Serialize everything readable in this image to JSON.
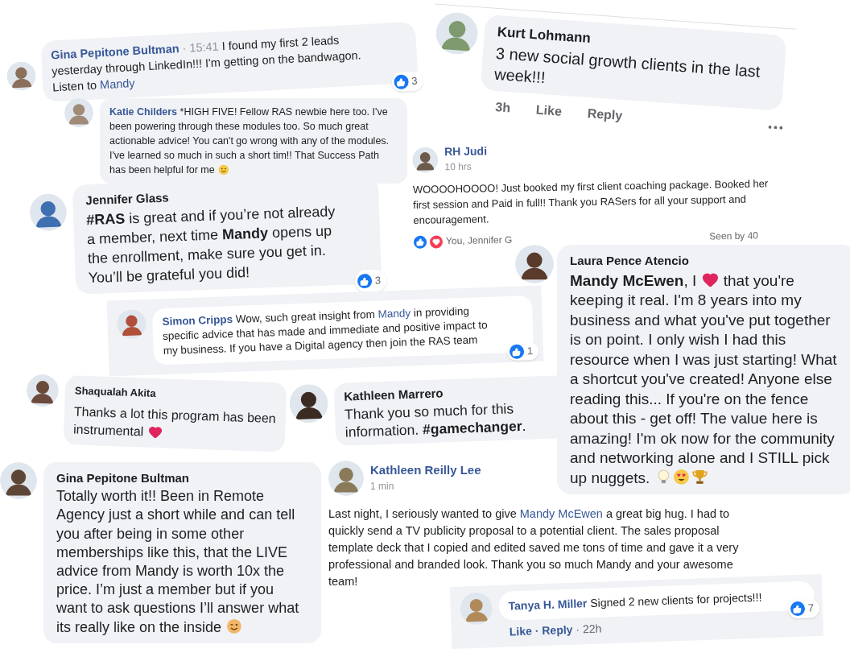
{
  "comments": [
    {
      "kind": "inline",
      "name": "Gina Pepitone Bultman",
      "time": "· 15:41",
      "text": [
        "I found my first 2 leads yesterday through LinkedIn!!! I'm getting on the bandwagon. Listen to ",
        {
          "kind": "link",
          "t": "Mandy"
        }
      ],
      "reactions": "3"
    },
    {
      "kind": "inline",
      "name": "Katie Childers",
      "text": [
        "*HIGH FIVE! Fellow RAS newbie here too. I've been powering through these modules too. So much great actionable advice! You can't go wrong with any of the modules. I've learned so much in such a short tim!! That Success Path has been helpful for me ",
        {
          "kind": "smile"
        }
      ]
    },
    {
      "kind": "bubble",
      "name": "Kurt Lohmann",
      "text": [
        "3 new social growth clients in the last week!!!"
      ],
      "actions": [
        "3h",
        "Like",
        "Reply"
      ],
      "more": true
    },
    {
      "kind": "post",
      "name": "RH Judi",
      "time": "10 hrs",
      "text": [
        "WOOOOHOOOO! Just booked my first client coaching package. Booked her first session and Paid in full!! Thank you RASers for all your support and encouragement."
      ],
      "liked_by": "You, Jennifer G",
      "seen": "Seen by 40"
    },
    {
      "kind": "bubble",
      "name": "Jennifer Glass",
      "text": [
        {
          "kind": "bold",
          "t": "#RAS"
        },
        " is great and if you’re not already a member, next time ",
        {
          "kind": "bold",
          "t": "Mandy"
        },
        " opens up the enrollment, make sure you get in. You’ll be grateful you did!"
      ],
      "reactions": "3"
    },
    {
      "kind": "inline",
      "name": "Simon Cripps",
      "text": [
        "Wow, such great insight from ",
        {
          "kind": "link",
          "t": "Mandy"
        },
        " in providing specific advice that has made and immediate and positive impact to my business. If you have a Digital agency then join the RAS team"
      ],
      "reactions": "1"
    },
    {
      "kind": "bubble",
      "name": "Laura Pence Atencio",
      "text": [
        {
          "kind": "bold",
          "t": "Mandy McEwen"
        },
        ", I ",
        {
          "kind": "heart"
        },
        " that you're keeping it real. I'm 8 years into my business and what you've put together is on point. I only wish I had this resource when I was just starting! What a shortcut you've created! Anyone else reading this... If you're on the fence about this - get off! The value here is amazing! I'm ok now for the community and networking alone and I STILL pick up nuggets. ",
        {
          "kind": "bulb"
        },
        {
          "kind": "hearteyes"
        },
        {
          "kind": "trophy"
        }
      ]
    },
    {
      "kind": "bubble",
      "name": "Shaqualah Akita",
      "text": [
        "Thanks a lot this program has been instrumental ",
        {
          "kind": "heart"
        }
      ]
    },
    {
      "kind": "bubble",
      "name": "Kathleen Marrero",
      "text": [
        "Thank you so much for this information. ",
        {
          "kind": "bold",
          "t": "#gamechanger"
        },
        "."
      ]
    },
    {
      "kind": "bubble",
      "name": "Gina Pepitone Bultman",
      "text": [
        "Totally worth it!!  Been in Remote Agency just a short while and can tell you after being in some other memberships like this, that the LIVE advice from Mandy is worth 10x the price.  I’m just a member but if you want to ask questions I’ll answer what its really like on the inside ",
        {
          "kind": "wink"
        }
      ]
    },
    {
      "kind": "post",
      "name": "Kathleen Reilly Lee",
      "time": "1 min",
      "text": [
        "Last night, I seriously wanted to give ",
        {
          "kind": "link",
          "t": "Mandy McEwen"
        },
        " a great big hug. I had to quickly send a TV publicity proposal to a potential client. The sales proposal template deck that I copied and edited saved me tons of time and gave it a very professional and branded look. Thank you so much Mandy and your awesome team!"
      ]
    },
    {
      "kind": "inline",
      "name": "Tanya H. Miller",
      "text": [
        "Signed 2 new clients for projects!!!"
      ],
      "reactions": "7",
      "actions": [
        "Like",
        "· Reply",
        "· 22h"
      ]
    }
  ]
}
